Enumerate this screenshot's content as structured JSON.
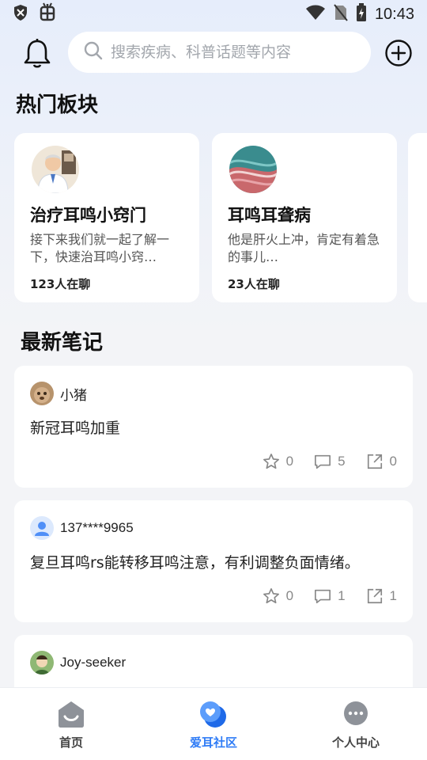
{
  "status_bar": {
    "time": "10:43",
    "left_icons": [
      "shield-icon",
      "bug-icon"
    ],
    "right_icons": [
      "wifi-icon",
      "no-sim-icon",
      "battery-charging-icon"
    ]
  },
  "header": {
    "bell_icon": "bell-icon",
    "search_placeholder": "搜索疾病、科普话题等内容",
    "add_icon": "plus-circle-icon"
  },
  "hot_section": {
    "title": "热门板块",
    "cards": [
      {
        "title": "治疗耳鸣小窍门",
        "desc": "接下来我们就一起了解一下，快速治耳鸣小窍…",
        "count": "123人在聊"
      },
      {
        "title": "耳鸣耳聋病",
        "desc": "他是肝火上冲，肯定有着急的事儿…",
        "count": "23人在聊"
      }
    ]
  },
  "notes_section": {
    "title": "最新笔记",
    "notes": [
      {
        "user": "小猪",
        "content": "新冠耳鸣加重",
        "likes": "0",
        "comments": "5",
        "shares": "0"
      },
      {
        "user": "137****9965",
        "content": "复旦耳鸣rs能转移耳鸣注意，有利调整负面情绪。",
        "likes": "0",
        "comments": "1",
        "shares": "1"
      },
      {
        "user": "Joy-seeker",
        "content": "",
        "likes": "",
        "comments": "",
        "shares": ""
      }
    ]
  },
  "bottom_nav": {
    "items": [
      {
        "label": "首页",
        "icon": "home-icon",
        "active": false
      },
      {
        "label": "爱耳社区",
        "icon": "community-chat-icon",
        "active": true
      },
      {
        "label": "个人中心",
        "icon": "profile-chat-icon",
        "active": false
      }
    ]
  },
  "colors": {
    "accent": "#2f7cf6",
    "background": "#f3f4f7"
  }
}
